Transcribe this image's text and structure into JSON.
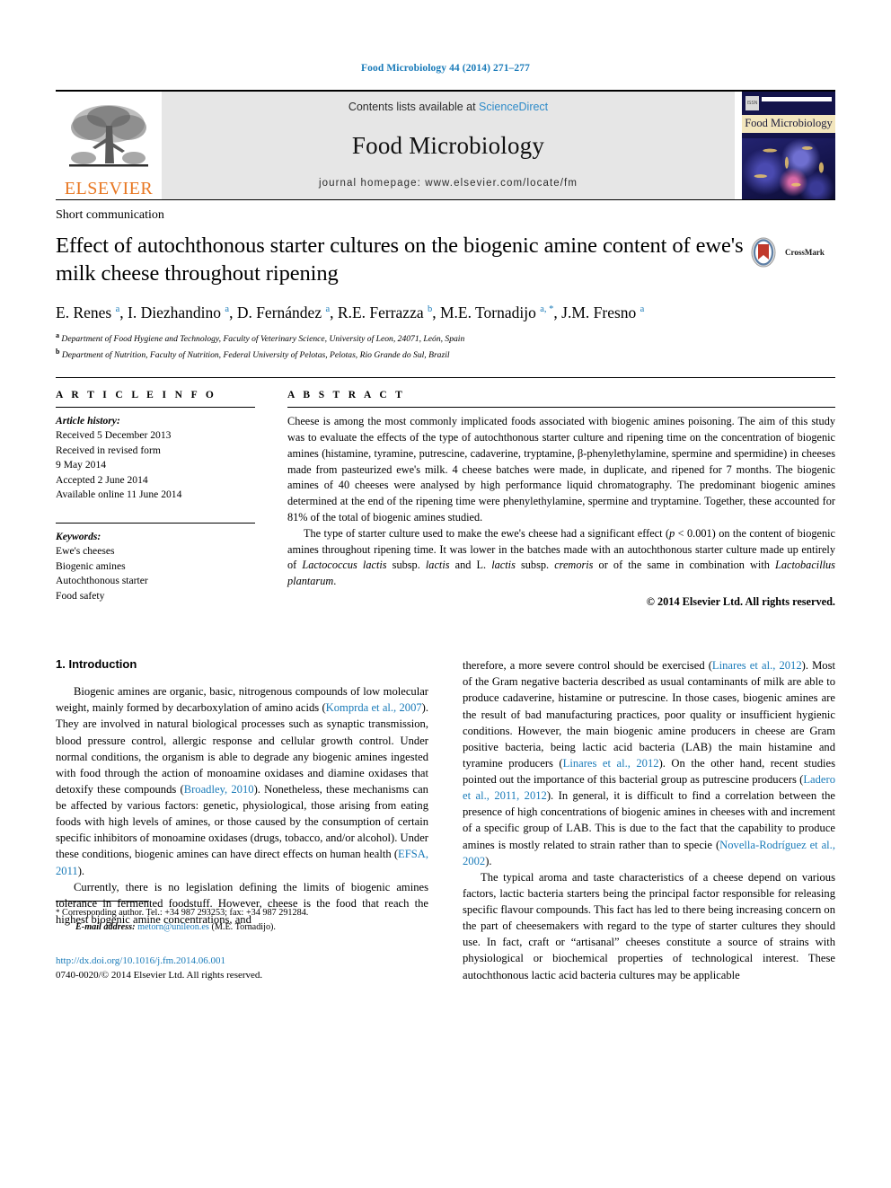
{
  "running_head": "Food Microbiology 44 (2014) 271–277",
  "masthead": {
    "publisher_name": "ELSEVIER",
    "contents_prefix": "Contents lists available at ",
    "contents_link": "ScienceDirect",
    "journal_title": "Food Microbiology",
    "journal_homepage": "journal homepage: www.elsevier.com/locate/fm",
    "cover_title": "Food Microbiology",
    "cover_badge": "ISSN"
  },
  "article": {
    "type_label": "Short communication",
    "title": "Effect of autochthonous starter cultures on the biogenic amine content of ewe's milk cheese throughout ripening",
    "crossmark_label": "CrossMark",
    "authors_html": "E. Renes <sup>a</sup>, I. Diezhandino <sup>a</sup>, D. Fernández <sup>a</sup>, R.E. Ferrazza <sup>b</sup>, M.E. Tornadijo <sup>a, *</sup>, J.M. Fresno <sup>a</sup>",
    "affiliations": [
      "Department of Food Hygiene and Technology, Faculty of Veterinary Science, University of Leon, 24071, León, Spain",
      "Department of Nutrition, Faculty of Nutrition, Federal University of Pelotas, Pelotas, Rio Grande do Sul, Brazil"
    ],
    "affiliation_marks": [
      "a",
      "b"
    ]
  },
  "article_info": {
    "heading": "A R T I C L E  I N F O",
    "history_label": "Article history:",
    "history": [
      "Received 5 December 2013",
      "Received in revised form",
      "9 May 2014",
      "Accepted 2 June 2014",
      "Available online 11 June 2014"
    ],
    "keywords_label": "Keywords:",
    "keywords": [
      "Ewe's cheeses",
      "Biogenic amines",
      "Autochthonous starter",
      "Food safety"
    ]
  },
  "abstract": {
    "heading": "A B S T R A C T",
    "paragraph_1": "Cheese is among the most commonly implicated foods associated with biogenic amines poisoning. The aim of this study was to evaluate the effects of the type of autochthonous starter culture and ripening time on the concentration of biogenic amines (histamine, tyramine, putrescine, cadaverine, tryptamine, β-phenylethylamine, spermine and spermidine) in cheeses made from pasteurized ewe's milk. 4 cheese batches were made, in duplicate, and ripened for 7 months. The biogenic amines of 40 cheeses were analysed by high performance liquid chromatography. The predominant biogenic amines determined at the end of the ripening time were phenylethylamine, spermine and tryptamine. Together, these accounted for 81% of the total of biogenic amines studied.",
    "paragraph_2_a": "The type of starter culture used to make the ewe's cheese had a significant effect (",
    "paragraph_2_p": "p",
    "paragraph_2_b": " < 0.001) on the content of biogenic amines throughout ripening time. It was lower in the batches made with an autochthonous starter culture made up entirely of ",
    "paragraph_2_sp1": "Lactococcus lactis",
    "paragraph_2_c": " subsp. ",
    "paragraph_2_sp2": "lactis",
    "paragraph_2_d": " and L. ",
    "paragraph_2_sp3": "lactis",
    "paragraph_2_e": " subsp. ",
    "paragraph_2_sp4": "cremoris",
    "paragraph_2_f": " or of the same in combination with ",
    "paragraph_2_sp5": "Lactobacillus plantarum",
    "paragraph_2_g": ".",
    "copyright": "© 2014 Elsevier Ltd. All rights reserved."
  },
  "introduction": {
    "heading": "1.  Introduction",
    "left": {
      "p1_a": "Biogenic amines are organic, basic, nitrogenous compounds of low molecular weight, mainly formed by decarboxylation of amino acids (",
      "p1_ref1": "Komprda et al., 2007",
      "p1_b": "). They are involved in natural biological processes such as synaptic transmission, blood pressure control, allergic response and cellular growth control. Under normal conditions, the organism is able to degrade any biogenic amines ingested with food through the action of monoamine oxidases and diamine oxidases that detoxify these compounds (",
      "p1_ref2": "Broadley, 2010",
      "p1_c": "). Nonetheless, these mechanisms can be affected by various factors: genetic, physiological, those arising from eating foods with high levels of amines, or those caused by the consumption of certain specific inhibitors of monoamine oxidases (drugs, tobacco, and/or alcohol). Under these conditions, biogenic amines can have direct effects on human health (",
      "p1_ref3": "EFSA, 2011",
      "p1_d": ").",
      "p2": "Currently, there is no legislation defining the limits of biogenic amines tolerance in fermented foodstuff. However, cheese is the food that reach the highest biogenic amine concentrations, and"
    },
    "right": {
      "p2_cont_a": "therefore, a more severe control should be exercised (",
      "p2_ref1": "Linares et al., 2012",
      "p2_cont_b": "). Most of the Gram negative bacteria described as usual contaminants of milk are able to produce cadaverine, histamine or putrescine. In those cases, biogenic amines are the result of bad manufacturing practices, poor quality or insufficient hygienic conditions. However, the main biogenic amine producers in cheese are Gram positive bacteria, being lactic acid bacteria (LAB) the main histamine and tyramine producers (",
      "p2_ref2": "Linares et al., 2012",
      "p2_cont_c": "). On the other hand, recent studies pointed out the importance of this bacterial group as putrescine producers (",
      "p2_ref3": "Ladero et al., 2011, 2012",
      "p2_cont_d": "). In general, it is difficult to find a correlation between the presence of high concentrations of biogenic amines in cheeses with and increment of a specific group of LAB. This is due to the fact that the capability to produce amines is mostly related to strain rather than to specie (",
      "p2_ref4": "Novella-Rodríguez et al., 2002",
      "p2_cont_e": ").",
      "p3": "The typical aroma and taste characteristics of a cheese depend on various factors, lactic bacteria starters being the principal factor responsible for releasing specific flavour compounds. This fact has led to there being increasing concern on the part of cheesemakers with regard to the type of starter cultures they should use. In fact, craft or “artisanal” cheeses constitute a source of strains with physiological or biochemical properties of technological interest. These autochthonous lactic acid bacteria cultures may be applicable"
    }
  },
  "footer": {
    "corresponding_star": "*",
    "corresponding_text": "Corresponding author. Tel.: +34 987 293253; fax: +34 987 291284.",
    "email_label": "E-mail address:",
    "email": "metorn@unileon.es",
    "email_owner": "(M.E. Tornadijo).",
    "doi": "http://dx.doi.org/10.1016/j.fm.2014.06.001",
    "issn_line": "0740-0020/© 2014 Elsevier Ltd. All rights reserved."
  },
  "colors": {
    "link_blue": "#1a7bb9",
    "sciencedirect_blue": "#2e8bc9",
    "elsevier_orange": "#E87722",
    "band_grey": "#e6e6e6",
    "cover_navy": "#14144b"
  }
}
